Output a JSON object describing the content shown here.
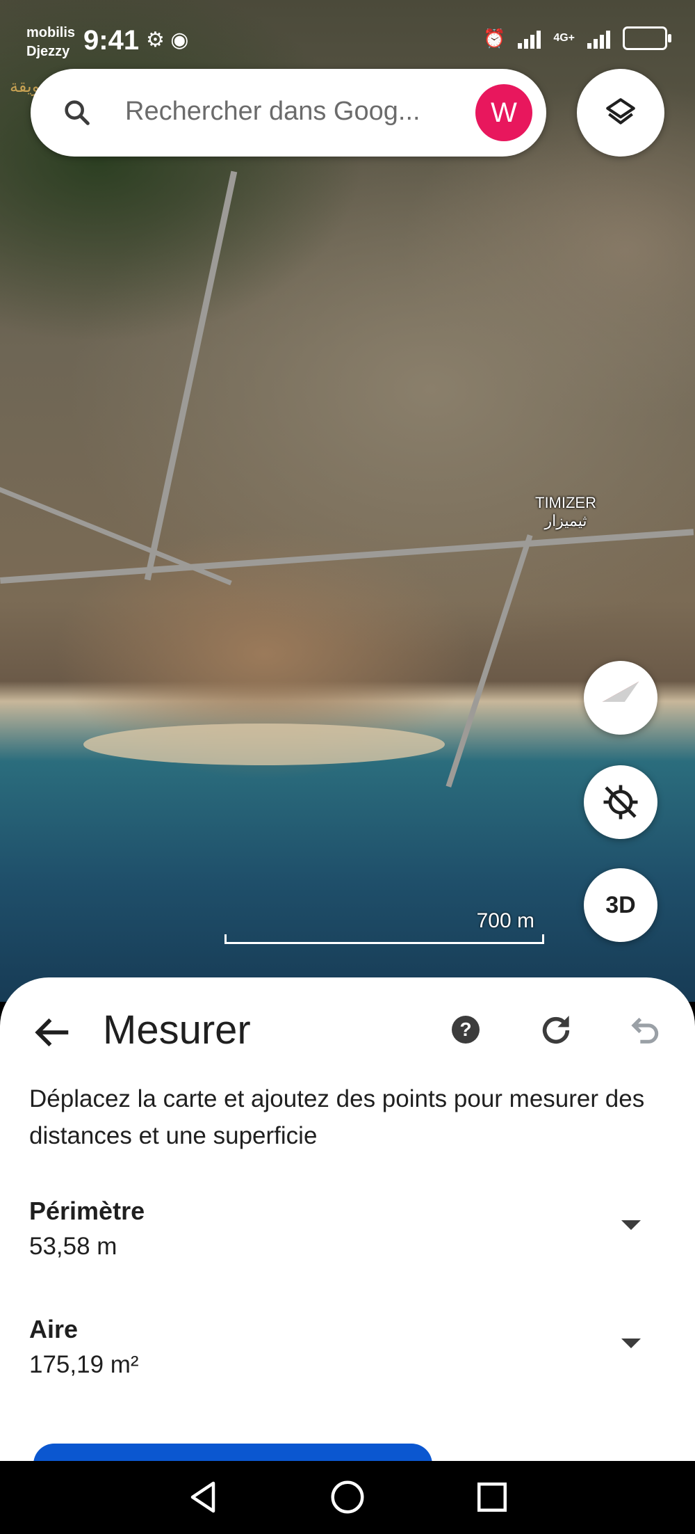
{
  "status_bar": {
    "carrier_line1": "mobilis",
    "carrier_line2": "Djezzy",
    "time": "9:41",
    "network": "4G+"
  },
  "watermark": "سويقة | Swiga",
  "map": {
    "place_label_latin": "TIMIZER",
    "place_label_arabic": "ثيميزار",
    "scale_label": "700 m",
    "button_3d": "3D"
  },
  "search": {
    "placeholder": "Rechercher dans Goog...",
    "avatar_letter": "W",
    "avatar_color": "#e8175d"
  },
  "measure_sheet": {
    "title": "Mesurer",
    "help_symbol": "?",
    "description": "Déplacez la carte et ajoutez des points pour mesurer des distances et une superficie",
    "perimeter_label": "Périmètre",
    "perimeter_value": "53,58 m",
    "area_label": "Aire",
    "area_value": "175,19 m²",
    "primary_button_color": "#0b57d0"
  }
}
